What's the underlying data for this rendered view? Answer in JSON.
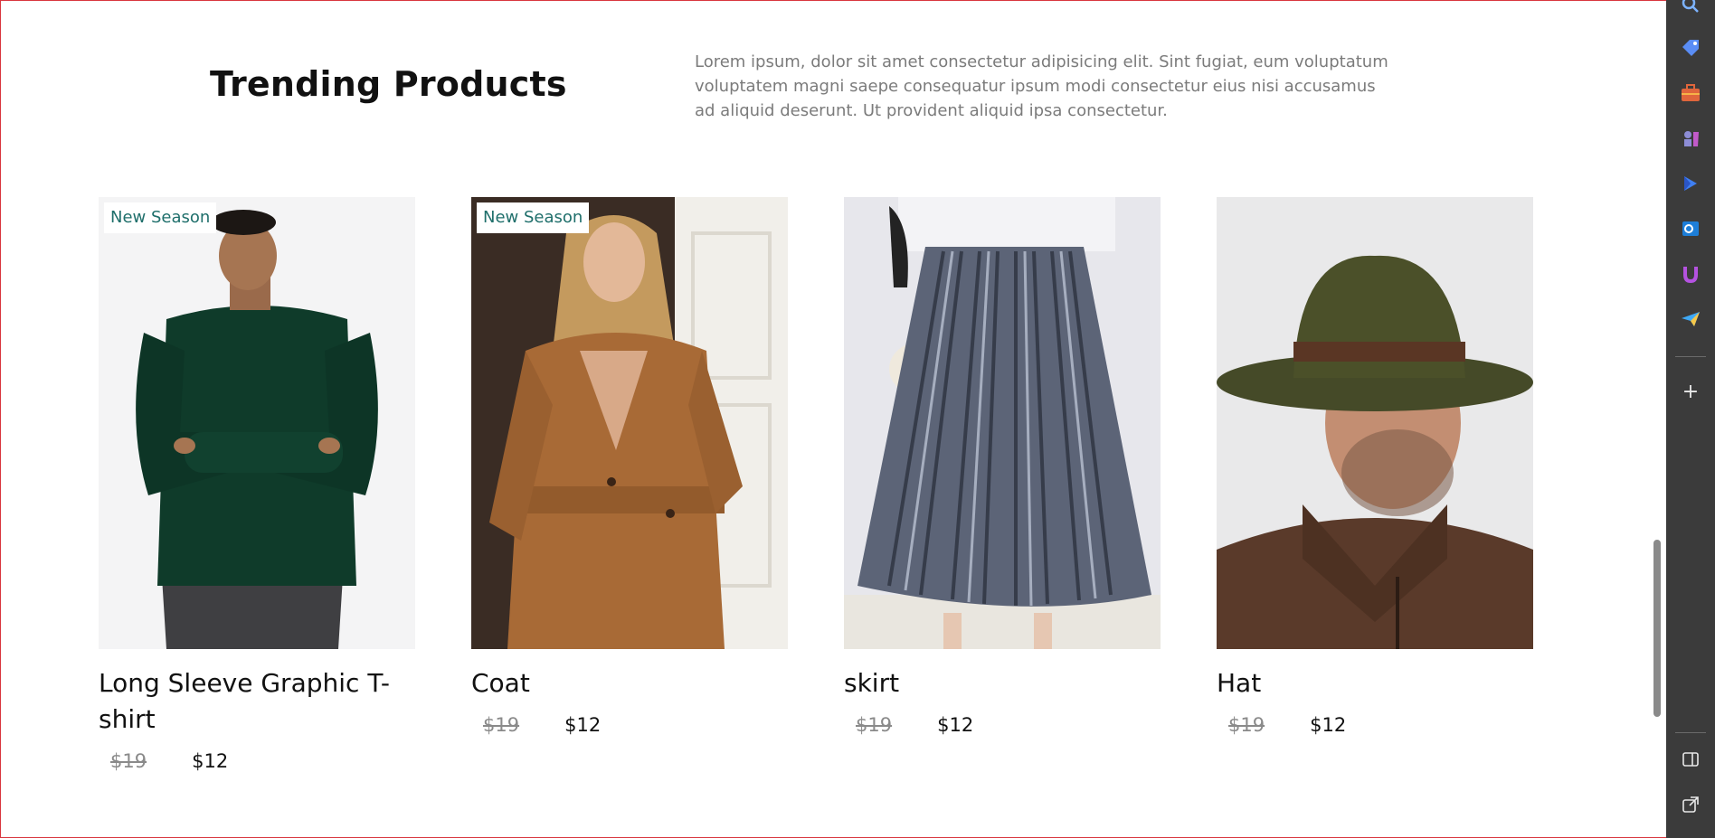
{
  "section": {
    "title": "Trending Products",
    "description": "Lorem ipsum, dolor sit amet consectetur adipisicing elit. Sint fugiat, eum voluptatum voluptatem magni saepe consequatur ipsum modi consectetur eius nisi accusamus ad aliquid deserunt. Ut provident aliquid ipsa consectetur."
  },
  "products": [
    {
      "name": "Long Sleeve Graphic T-shirt",
      "badge": "New Season",
      "old_price": "$19",
      "price": "$12",
      "image": "man-in-green-long-sleeve-shirt"
    },
    {
      "name": "Coat",
      "badge": "New Season",
      "old_price": "$19",
      "price": "$12",
      "image": "woman-in-camel-belted-coat"
    },
    {
      "name": "skirt",
      "badge": "",
      "old_price": "$19",
      "price": "$12",
      "image": "grey-pleated-velvet-skirt"
    },
    {
      "name": "Hat",
      "badge": "",
      "old_price": "$19",
      "price": "$12",
      "image": "man-in-olive-fedora-hat"
    }
  ],
  "colors": {
    "badge_text": "#1f6f6b",
    "old_price": "#8a8a8a",
    "sidebar_bg": "#3b3b3b",
    "viewport_border": "#d9363e"
  },
  "sidebar": {
    "icons": [
      "search-icon",
      "tag-icon",
      "briefcase-icon",
      "chess-icon",
      "copilot-icon",
      "outlook-icon",
      "magnet-icon",
      "send-icon",
      "add-icon",
      "split-screen-icon",
      "open-external-icon"
    ]
  }
}
